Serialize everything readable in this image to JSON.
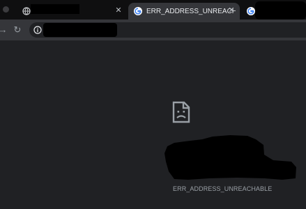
{
  "tabs": [
    {
      "title": "",
      "active": false,
      "favicon": "globe-icon",
      "closable": true
    },
    {
      "title": "ERR_ADDRESS_UNREACHABLE",
      "active": true,
      "favicon": "google-icon",
      "closable": true
    },
    {
      "title": "",
      "active": false,
      "favicon": "google-icon",
      "closable": false
    }
  ],
  "toolbar": {
    "forward_icon": "arrow-forward-icon",
    "reload_icon": "reload-icon",
    "site_info_icon": "info-icon",
    "url": ""
  },
  "page": {
    "error_icon": "sad-document-icon",
    "error_code": "ERR_ADDRESS_UNREACHABLE"
  },
  "colors": {
    "background": "#202124",
    "tabstrip": "#0f0f10",
    "toolbar": "#35363a",
    "text_muted": "#9aa0a6"
  }
}
